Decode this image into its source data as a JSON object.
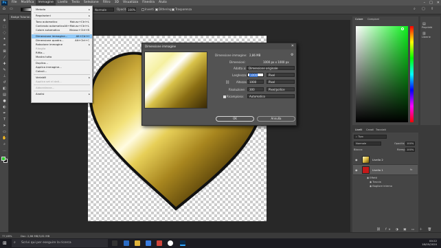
{
  "menubar": {
    "logo": "Ps",
    "items": [
      "File",
      "Modifica",
      "Immagine",
      "Livello",
      "Testo",
      "Selezione",
      "Filtro",
      "3D",
      "Visualizza",
      "Finestra",
      "Aiuto"
    ],
    "active_index": 2
  },
  "optionsbar": {
    "mode_value": "Normale",
    "opacity_label": "Opacità:",
    "opacity_value": "100%",
    "inverti_label": "Inverti",
    "dithering_label": "Dithering",
    "trasparenza_label": "Trasparenza"
  },
  "document": {
    "tab_label": "Badge Tutorial.psd"
  },
  "image_menu": {
    "items": [
      {
        "label": "Metodo",
        "shortcut": "",
        "submenu": true,
        "state": "normal"
      },
      {
        "sep": true
      },
      {
        "label": "Regolazioni",
        "shortcut": "",
        "submenu": true,
        "state": "normal"
      },
      {
        "sep": true
      },
      {
        "label": "Tono automatico",
        "shortcut": "Maiusc+Ctrl+L",
        "state": "normal"
      },
      {
        "label": "Contrasto automatico",
        "shortcut": "Alt+Maiusc+Ctrl+L",
        "state": "normal"
      },
      {
        "label": "Colore automatico",
        "shortcut": "Maiusc+Ctrl+B",
        "state": "normal"
      },
      {
        "sep": true
      },
      {
        "label": "Dimensione immagine...",
        "shortcut": "Alt+Ctrl+I",
        "state": "selected"
      },
      {
        "label": "Dimensione quadro...",
        "shortcut": "Alt+Ctrl+C",
        "state": "normal"
      },
      {
        "label": "Rotazione immagine",
        "shortcut": "",
        "submenu": true,
        "state": "normal"
      },
      {
        "label": "Ritaglia",
        "shortcut": "",
        "state": "disabled"
      },
      {
        "label": "Rifila...",
        "shortcut": "",
        "state": "normal"
      },
      {
        "label": "Mostra tutto",
        "shortcut": "",
        "state": "normal"
      },
      {
        "sep": true
      },
      {
        "label": "Duplica...",
        "shortcut": "",
        "state": "normal"
      },
      {
        "label": "Applica immagine...",
        "shortcut": "",
        "state": "normal"
      },
      {
        "label": "Calcoli...",
        "shortcut": "",
        "state": "normal"
      },
      {
        "sep": true
      },
      {
        "label": "Variabili",
        "shortcut": "",
        "submenu": true,
        "state": "normal"
      },
      {
        "label": "Applica set di dati...",
        "shortcut": "",
        "state": "disabled"
      },
      {
        "sep": true
      },
      {
        "label": "Abbondanza...",
        "shortcut": "",
        "state": "disabled"
      },
      {
        "sep": true
      },
      {
        "label": "Analisi",
        "shortcut": "",
        "submenu": true,
        "state": "normal"
      }
    ]
  },
  "dialog": {
    "title": "Dimensione immagine",
    "size_label": "Dimensione immagine:",
    "size_value": "2,86 MB",
    "dimensions_label": "Dimensioni:",
    "dimensions_value": "1000 px x 1000 px",
    "fit_label": "Adatta a:",
    "fit_value": "Dimensione originale",
    "width_label": "Larghezza:",
    "width_value": "1000",
    "width_unit": "Pixel",
    "height_label": "Altezza:",
    "height_value": "1000",
    "height_unit": "Pixel",
    "resolution_label": "Risoluzione:",
    "resolution_value": "300",
    "resolution_unit": "Pixel/pollice",
    "resample_label": "Ricampiona:",
    "resample_value": "Automatico",
    "ok_label": "OK",
    "cancel_label": "Annulla"
  },
  "panels": {
    "color_tab": "Colore",
    "swatches_tab": "Campioni",
    "properties_label": "Proprietà",
    "library_label": "Librerie",
    "layers_tab": "Livelli",
    "channels_tab": "Canali",
    "paths_tab": "Tracciati",
    "filter_label": "Tipo",
    "blend_value": "Normale",
    "opacity_label": "Opacità:",
    "opacity_value": "100%",
    "lock_label": "Blocca:",
    "fill_label": "Riemp.:",
    "fill_value": "100%",
    "layers": [
      {
        "name": "Livello 2",
        "selected": false
      },
      {
        "name": "Livello 1",
        "selected": true
      }
    ],
    "effects_label": "Effetti",
    "effect1": "Traccia",
    "effect2": "Bagliore interno",
    "fx_label": "fx"
  },
  "status": {
    "zoom": "77,08%",
    "doc": "Doc: 2,86 MB/3,81 MB"
  },
  "taskbar": {
    "search_placeholder": "Scrivi qui per eseguire la ricerca",
    "time": "00:22",
    "date": "18/05/2020"
  },
  "colors": {
    "accent": "#31a8ff",
    "foreground": "#2dcf2d",
    "menu_selected": "#91c9f7"
  }
}
